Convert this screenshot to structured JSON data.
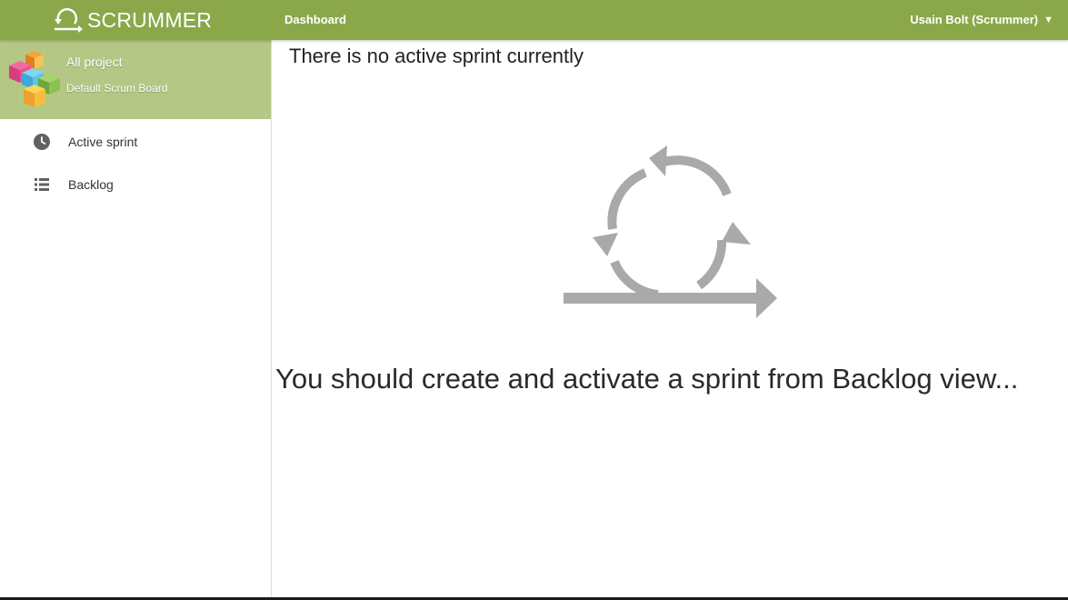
{
  "topbar": {
    "brand": "SCRUMMER",
    "nav_dashboard": "Dashboard",
    "user_menu": "Usain Bolt (Scrummer)",
    "user_menu_caret": "▼"
  },
  "sidebar": {
    "project_name": "All project",
    "board_name": "Default Scrum Board",
    "items": [
      {
        "label": "Active sprint",
        "icon": "clock-icon"
      },
      {
        "label": "Backlog",
        "icon": "list-icon"
      }
    ]
  },
  "main": {
    "title": "There is no active sprint currently",
    "hint": "You should create and activate a sprint from Backlog view..."
  },
  "colors": {
    "topbar": "#8aa84a",
    "project_header": "#b4c785",
    "graphic": "#a9a9a9"
  }
}
